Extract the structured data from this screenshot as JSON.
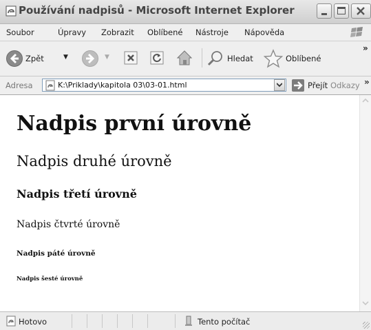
{
  "window": {
    "title": "Používání nadpisů - Microsoft Internet Explorer"
  },
  "menu": [
    "Soubor",
    "Úpravy",
    "Zobrazit",
    "Oblíbené",
    "Nástroje",
    "Nápověda"
  ],
  "toolbar": {
    "back_label": "Zpět",
    "search_label": "Hledat",
    "favorites_label": "Oblíbené",
    "overflow": "»"
  },
  "address": {
    "label": "Adresa",
    "url": "K:\\Priklady\\kapitola 03\\03-01.html",
    "go_label": "Přejít",
    "links_label": "Odkazy",
    "overflow": "»"
  },
  "page": {
    "h1": "Nadpis první úrovně",
    "h2": "Nadpis druhé úrovně",
    "h3": "Nadpis třetí úrovně",
    "h4": "Nadpis čtvrté úrovně",
    "h5": "Nadpis páté úrovně",
    "h6": "Nadpis šesté úrovně"
  },
  "status": {
    "text": "Hotovo",
    "zone": "Tento počítač"
  }
}
